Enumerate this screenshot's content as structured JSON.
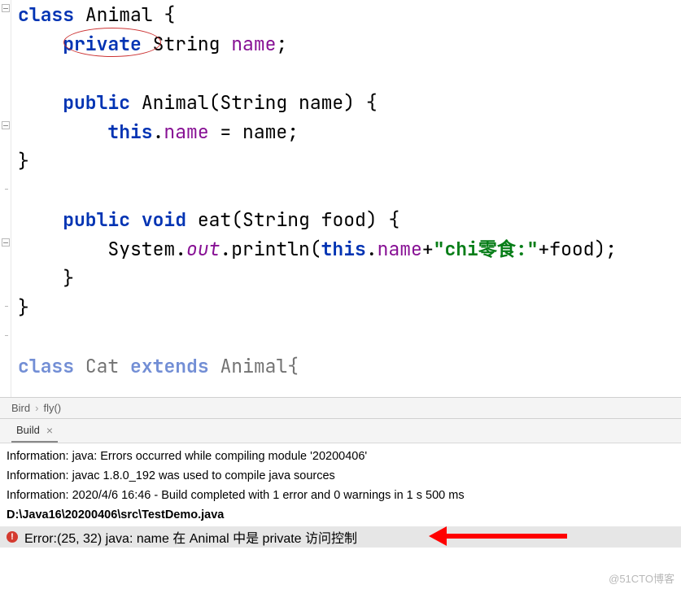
{
  "code": {
    "kw_class": "class",
    "cls_animal": "Animal",
    "kw_private": "private",
    "type_string": "String",
    "field_name": "name",
    "kw_public": "public",
    "ctor": "Animal(String name)",
    "kw_this": "this",
    "assign_rhs": " = name;",
    "kw_void": "void",
    "method_eat": "eat(String food)",
    "sys": "System.",
    "out": "out",
    "println": ".println(",
    "plus": "+",
    "str_chi": "\"chi零食:\"",
    "plus_food": "+food);",
    "cat_line_prefix": "Cat",
    "kw_extends": "extends",
    "cat_line_suffix": "Animal{"
  },
  "nav": {
    "crumb1": "Bird",
    "crumb2": "fly()"
  },
  "panel": {
    "tab_build": "Build"
  },
  "msgs": {
    "m1": "Information: java: Errors occurred while compiling module '20200406'",
    "m2": "Information: javac 1.8.0_192 was used to compile java sources",
    "m3": "Information: 2020/4/6 16:46 - Build completed with 1 error and 0 warnings in 1 s 500 ms",
    "m4": "D:\\Java16\\20200406\\src\\TestDemo.java",
    "err": "Error:(25, 32)  java: name 在 Animal 中是 private 访问控制"
  },
  "watermark": "@51CTO博客"
}
